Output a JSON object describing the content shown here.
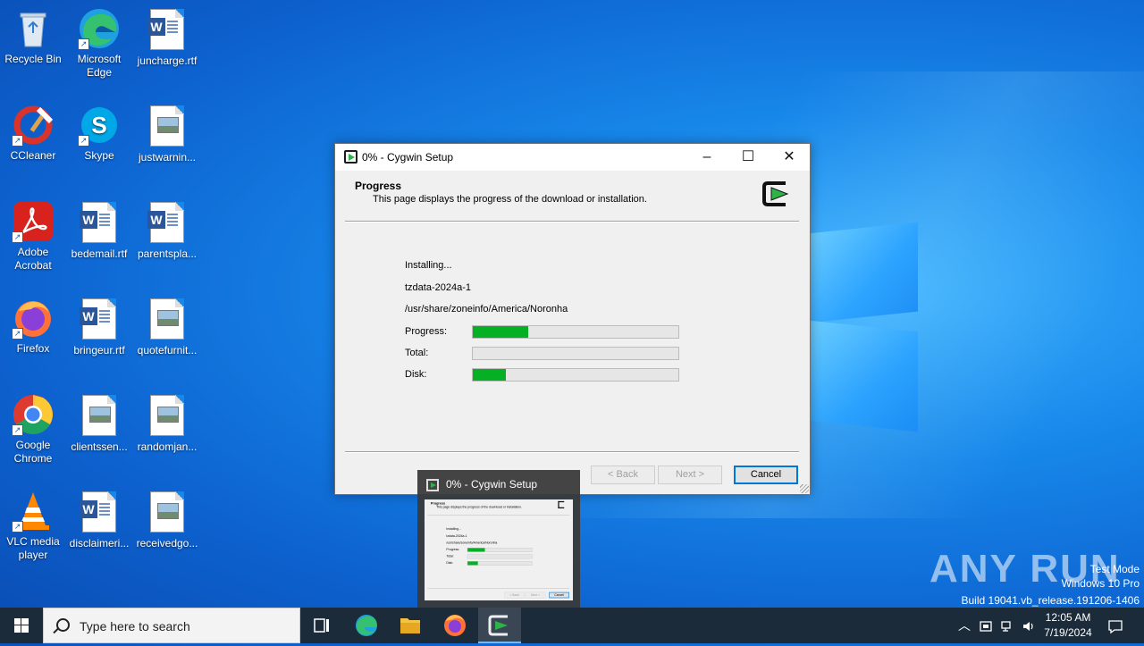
{
  "desktop": {
    "icons": [
      {
        "label": "Recycle Bin"
      },
      {
        "label": "Microsoft Edge"
      },
      {
        "label": "juncharge.rtf"
      },
      {
        "label": "CCleaner"
      },
      {
        "label": "Skype"
      },
      {
        "label": "justwarnin..."
      },
      {
        "label": "Adobe Acrobat"
      },
      {
        "label": "bedemail.rtf"
      },
      {
        "label": "parentspla..."
      },
      {
        "label": "Firefox"
      },
      {
        "label": "bringeur.rtf"
      },
      {
        "label": "quotefurnit..."
      },
      {
        "label": "Google Chrome"
      },
      {
        "label": "clientssen..."
      },
      {
        "label": "randomjan..."
      },
      {
        "label": "VLC media player"
      },
      {
        "label": "disclaimeri..."
      },
      {
        "label": "receivedgo..."
      }
    ]
  },
  "dialog": {
    "title": "0% - Cygwin Setup",
    "header_title": "Progress",
    "header_subtitle": "This page displays the progress of the download or installation.",
    "status": "Installing...",
    "package": "tzdata-2024a-1",
    "path": "/usr/share/zoneinfo/America/Noronha",
    "progress_label": "Progress:",
    "total_label": "Total:",
    "disk_label": "Disk:",
    "progress_percent": 27,
    "total_percent": 0,
    "disk_percent": 16,
    "back_label": "< Back",
    "next_label": "Next >",
    "cancel_label": "Cancel"
  },
  "preview": {
    "title": "0% - Cygwin Setup"
  },
  "watermark": {
    "brand": "ANY RUN",
    "line1": "Test Mode",
    "line2": "Windows 10 Pro",
    "line3": "Build 19041.vb_release.191206-1406"
  },
  "taskbar": {
    "search_placeholder": "Type here to search",
    "time": "12:05 AM",
    "date": "7/19/2024"
  },
  "colors": {
    "progress_green": "#06b025",
    "accent": "#0078d7"
  }
}
